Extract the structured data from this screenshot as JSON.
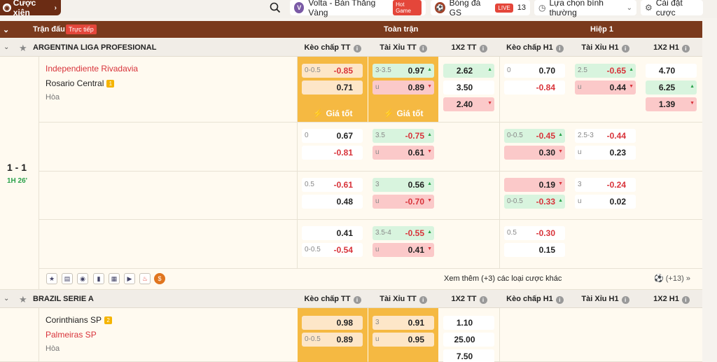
{
  "topbar": {
    "parlay_label": "Cược xiên",
    "volta_label": "Volta - Bàn Thắng Vàng",
    "hot_badge": "Hot Game",
    "bongda_label": "Bóng đá GS",
    "live_badge": "LIVE",
    "live_count": "13",
    "sort_label": "Lựa chọn bình thường",
    "settings_label": "Cài đặt cược"
  },
  "header": {
    "match_col": "Trận đấu",
    "live_tag": "Trực tiếp",
    "full_time": "Toàn trận",
    "first_half": "Hiệp 1"
  },
  "columns": [
    "Kèo chấp TT",
    "Tài Xỉu TT",
    "1X2 TT",
    "Kèo chấp H1",
    "Tài Xỉu H1",
    "1X2 H1"
  ],
  "league1": {
    "name": "ARGENTINA LIGA PROFESIONAL"
  },
  "match1": {
    "score": "1 - 1",
    "time": "1H 26'",
    "home": "Independiente Rivadavia",
    "away": "Rosario Central",
    "away_rank": "1",
    "draw": "Hòa",
    "good_label": "Giá tốt",
    "r1": {
      "hc_h": "0-0.5",
      "hc_v1": "-0.85",
      "hc_v2": "0.71",
      "ou_h": "3-3.5",
      "ou_v1": "0.97",
      "ou_u": "u",
      "ou_v2": "0.89",
      "x1": "2.62",
      "x2": "3.50",
      "x3": "2.40",
      "h1hc_h": "0",
      "h1hc_v1": "0.70",
      "h1hc_v2": "-0.84",
      "h1ou_h": "2.5",
      "h1ou_v1": "-0.65",
      "h1ou_u": "u",
      "h1ou_v2": "0.44",
      "h1x1": "4.70",
      "h1x2": "6.25",
      "h1x3": "1.39"
    },
    "r2": {
      "hc_h": "0",
      "hc_v1": "0.67",
      "hc_v2": "-0.81",
      "ou_h": "3.5",
      "ou_v1": "-0.75",
      "ou_u": "u",
      "ou_v2": "0.61",
      "h1hc_h": "0-0.5",
      "h1hc_v1": "-0.45",
      "h1hc_v2": "0.30",
      "h1ou_h": "2.5-3",
      "h1ou_v1": "-0.44",
      "h1ou_u": "u",
      "h1ou_v2": "0.23"
    },
    "r3": {
      "hc_h": "0.5",
      "hc_v1": "-0.61",
      "hc_v2": "0.48",
      "ou_h": "3",
      "ou_v1": "0.56",
      "ou_u": "u",
      "ou_v2": "-0.70",
      "h1hc_v1": "0.19",
      "h1hc_h2": "0-0.5",
      "h1hc_v2": "-0.33",
      "h1ou_h": "3",
      "h1ou_v1": "-0.24",
      "h1ou_u": "u",
      "h1ou_v2": "0.02"
    },
    "r4": {
      "hc_v1": "0.41",
      "hc_h2": "0-0.5",
      "hc_v2": "-0.54",
      "ou_h": "3.5-4",
      "ou_v1": "-0.55",
      "ou_u": "u",
      "ou_v2": "0.41",
      "h1hc_h": "0.5",
      "h1hc_v1": "-0.30",
      "h1hc_v2": "0.15"
    },
    "more": "Xem thêm (+3) các loại cược khác",
    "plus": "(+13)"
  },
  "league2": {
    "name": "BRAZIL SERIE A"
  },
  "match2": {
    "home": "Corinthians SP",
    "home_rank": "2",
    "away": "Palmeiras SP",
    "draw": "Hòa",
    "r1": {
      "hc_v1": "0.98",
      "hc_h2": "0-0.5",
      "hc_v2": "0.89",
      "ou_h": "3",
      "ou_v1": "0.91",
      "ou_u": "u",
      "ou_v2": "0.95",
      "x1": "1.10",
      "x2": "25.00",
      "x3": "7.50"
    }
  }
}
